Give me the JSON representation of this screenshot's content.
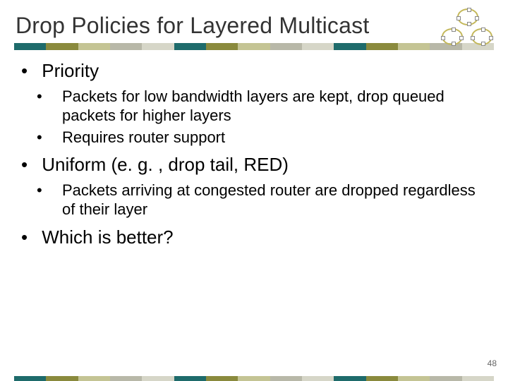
{
  "title": "Drop Policies for Layered Multicast",
  "bullets": {
    "b1": "Priority",
    "b1_1": "Packets for low bandwidth layers are kept, drop queued packets for higher layers",
    "b1_2": "Requires router support",
    "b2": "Uniform (e. g. , drop tail, RED)",
    "b2_1": "Packets arriving at congested router are dropped regardless of their layer",
    "b3": "Which is better?"
  },
  "page_number": "48"
}
